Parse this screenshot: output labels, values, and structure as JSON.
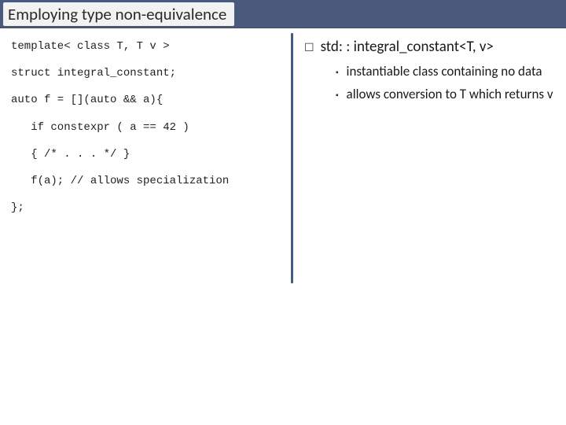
{
  "title": "Employing type non-equivalence",
  "code": {
    "l1": "template< class T, T v >",
    "l2": "struct integral_constant;",
    "l3": "auto f = [](auto && a){",
    "l4": "   if constexpr ( a == 42 )",
    "l5": "   { /* . . . */ }",
    "l6": "   f(a); // allows specialization",
    "l7": "};"
  },
  "right": {
    "heading": "std: : integral_constant<T, v>",
    "points": [
      "instantiable class containing no data",
      "allows conversion to T which returns v"
    ]
  }
}
